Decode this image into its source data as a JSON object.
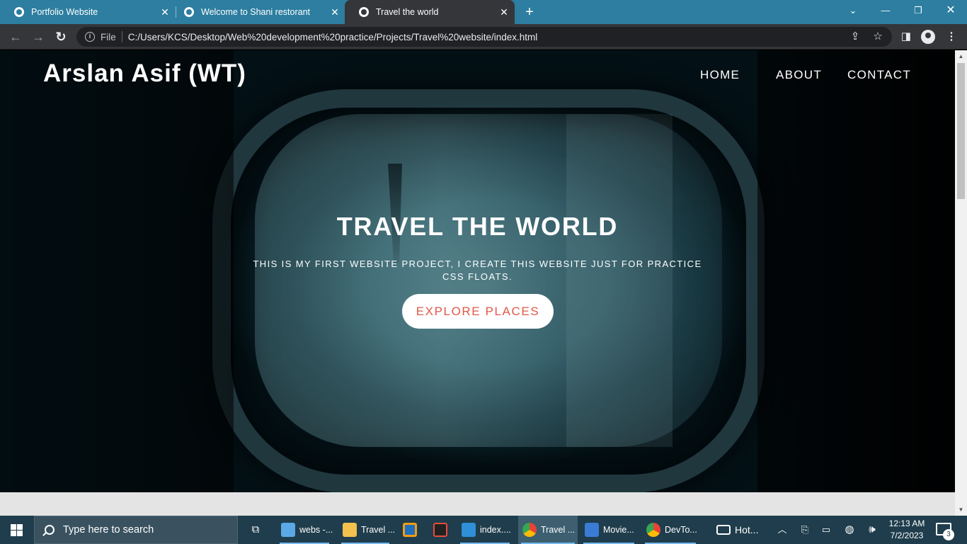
{
  "browser": {
    "tabs": [
      {
        "title": "Portfolio Website",
        "active": false
      },
      {
        "title": "Welcome to Shani restorant",
        "active": false
      },
      {
        "title": "Travel the world",
        "active": true
      }
    ],
    "new_tab_symbol": "+",
    "close_symbol": "✕",
    "scheme_label": "File",
    "url": "C:/Users/KCS/Desktop/Web%20development%20practice/Projects/Travel%20website/index.html",
    "icons": [
      "back-arrow-icon",
      "forward-arrow-icon",
      "reload-icon",
      "info-icon",
      "share-icon",
      "bookmark-star-icon",
      "side-panel-icon",
      "profile-icon",
      "menu-kebab-icon"
    ]
  },
  "page": {
    "brand": "Arslan Asif (WT)",
    "nav": [
      "HOME",
      "ABOUT",
      "CONTACT"
    ],
    "hero_title": "TRAVEL THE WORLD",
    "hero_subtitle": "THIS IS MY FIRST WEBSITE PROJECT, I CREATE THIS WEBSITE JUST FOR PRACTICE CSS FLOATS.",
    "cta_label": "EXPLORE PLACES",
    "colors": {
      "cta_text": "#e0584a",
      "cta_bg": "#ffffff",
      "hero_text": "#ffffff"
    }
  },
  "taskbar": {
    "search_placeholder": "Type here to search",
    "items": [
      {
        "label": "webs -...",
        "icon": "folder-3d-icon"
      },
      {
        "label": "Travel ...",
        "icon": "file-explorer-icon"
      },
      {
        "label": "",
        "icon": "virtualbox-icon"
      },
      {
        "label": "",
        "icon": "7zip-icon"
      },
      {
        "label": "index....",
        "icon": "vscode-icon"
      },
      {
        "label": "Travel ...",
        "icon": "chrome-icon"
      },
      {
        "label": "Movie...",
        "icon": "movie-maker-icon"
      },
      {
        "label": "DevTo...",
        "icon": "chrome-icon"
      },
      {
        "label": "Hot...",
        "icon": "hotspot-icon"
      }
    ],
    "clock_time": "12:13 AM",
    "clock_date": "7/2/2023",
    "notification_count": "3"
  }
}
